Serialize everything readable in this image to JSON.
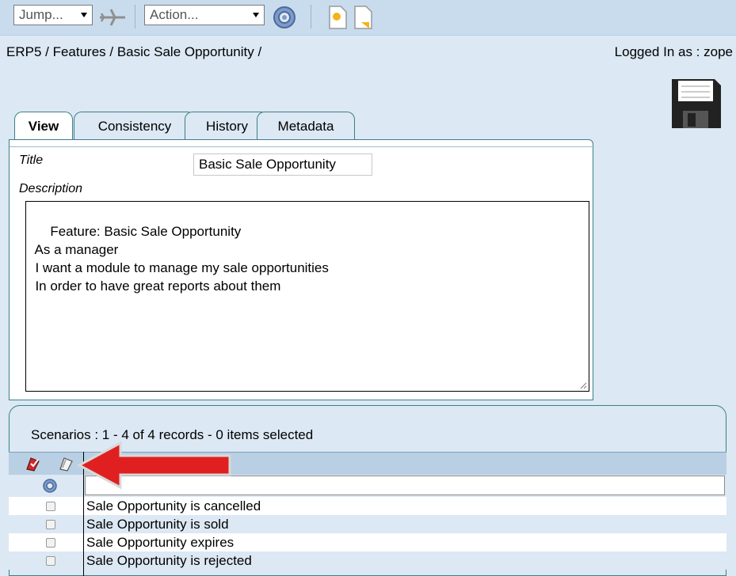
{
  "toolbar": {
    "jump_label": "Jump...",
    "action_label": "Action..."
  },
  "breadcrumb": "ERP5 / Features / Basic Sale Opportunity /",
  "logged_in": "Logged In as : zope",
  "tabs": [
    {
      "label": "View"
    },
    {
      "label": "Consistency"
    },
    {
      "label": "History"
    },
    {
      "label": "Metadata"
    }
  ],
  "form": {
    "title_label": "Title",
    "title_value": "Basic Sale Opportunity",
    "description_label": "Description",
    "description_value": "Feature: Basic Sale Opportunity\n  As a manager\n  I want a module to manage my sale opportunities\n  In order to have great reports about them"
  },
  "listbox": {
    "title": "Scenarios : 1 - 4 of 4 records - 0 items selected",
    "rows": [
      {
        "title": "Sale Opportunity is cancelled"
      },
      {
        "title": "Sale Opportunity is sold"
      },
      {
        "title": "Sale Opportunity expires"
      },
      {
        "title": "Sale Opportunity is rejected"
      }
    ]
  },
  "colors": {
    "background": "#dce8f3",
    "tab_border": "#3a7f88",
    "annotation_arrow": "#e02020"
  }
}
